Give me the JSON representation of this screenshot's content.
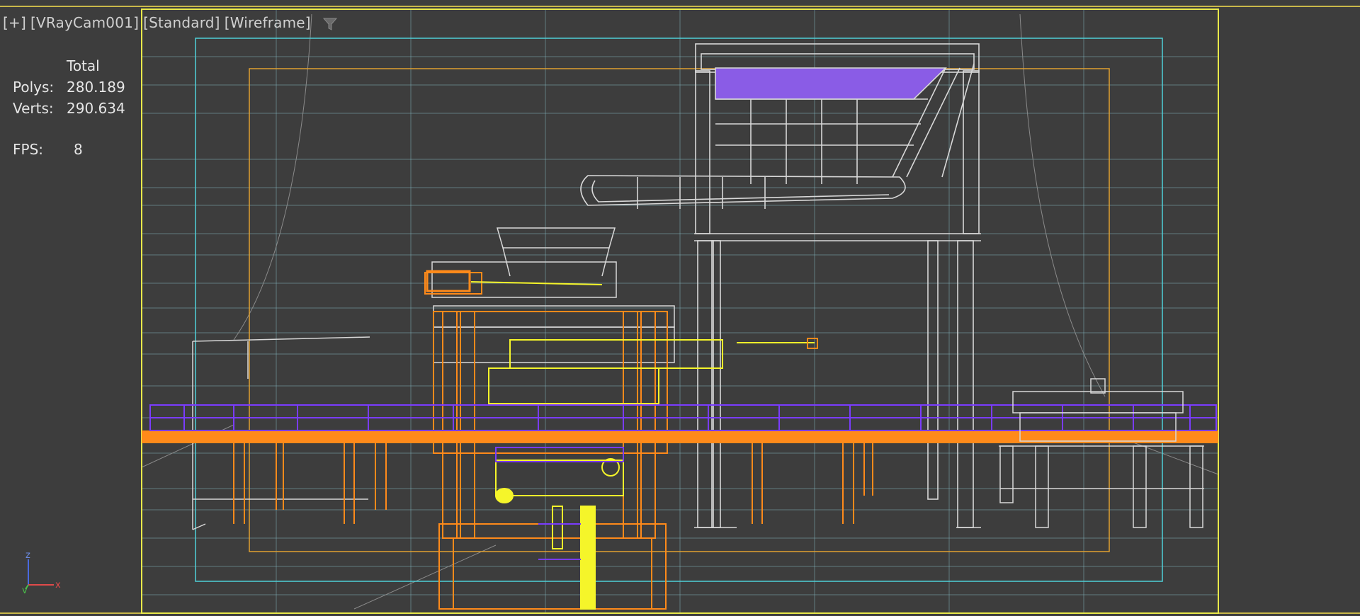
{
  "viewport": {
    "labels": [
      "[+]",
      "[VRayCam001]",
      "[Standard]",
      "[Wireframe]"
    ],
    "filter_icon": "funnel-icon"
  },
  "stats": {
    "header": "Total",
    "polys_label": "Polys:",
    "polys_value": "280.189",
    "verts_label": "Verts:",
    "verts_value": "290.634",
    "fps_label": "FPS:",
    "fps_value": "8"
  },
  "axis": {
    "z": "z",
    "y": "y",
    "x": "x"
  },
  "colors": {
    "background": "#3d3d3d",
    "safe_frame_outer": "#e8e84a",
    "safe_frame_action": "#4fd0d8",
    "safe_frame_title": "#e0a030",
    "wire_white": "#d8d8d8",
    "wire_orange": "#ff8a1a",
    "wire_yellow": "#f5f52a",
    "wire_purple": "#7a3cff",
    "fill_purple": "#8a5ce6"
  }
}
